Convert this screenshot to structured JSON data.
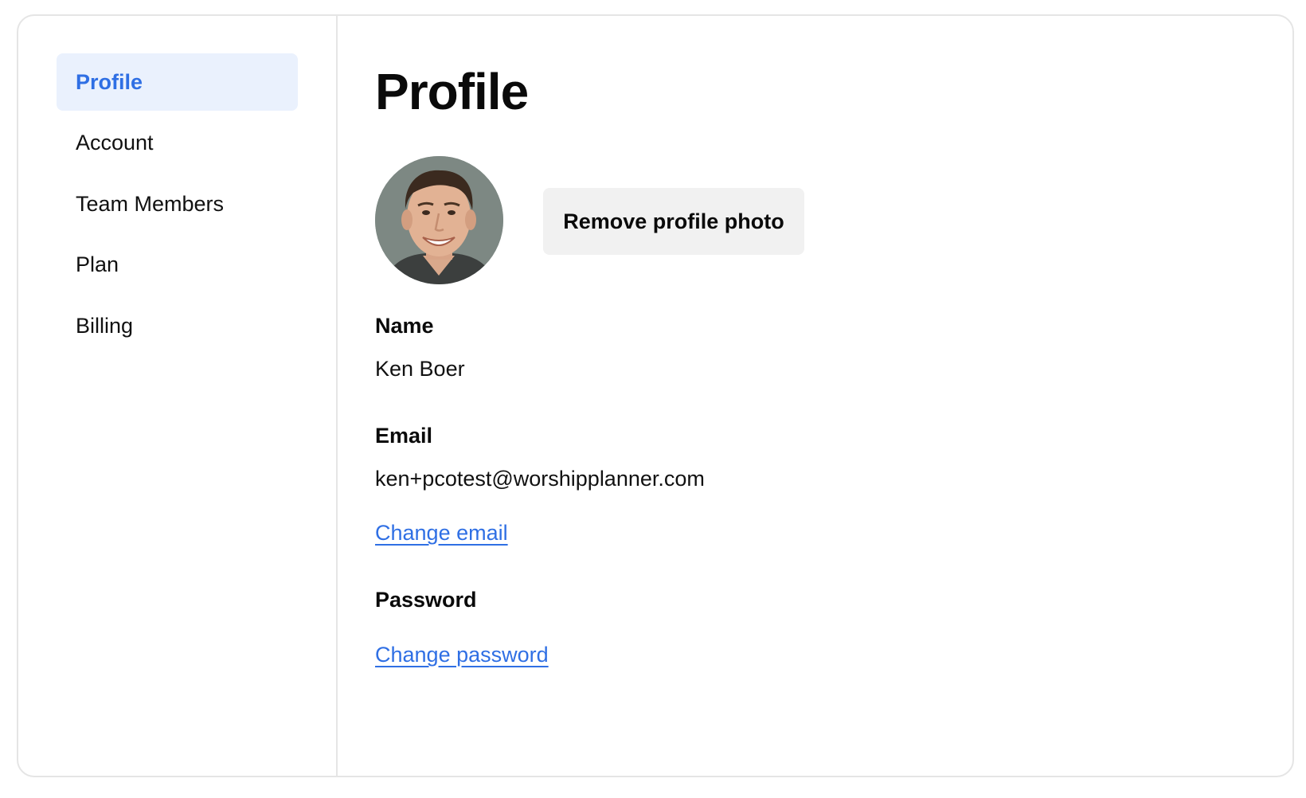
{
  "sidebar": {
    "items": [
      {
        "label": "Profile",
        "active": true
      },
      {
        "label": "Account",
        "active": false
      },
      {
        "label": "Team Members",
        "active": false
      },
      {
        "label": "Plan",
        "active": false
      },
      {
        "label": "Billing",
        "active": false
      }
    ]
  },
  "main": {
    "title": "Profile",
    "remove_photo_label": "Remove profile photo",
    "name": {
      "label": "Name",
      "value": "Ken Boer"
    },
    "email": {
      "label": "Email",
      "value": "ken+pcotest@worshipplanner.com",
      "change_link": "Change email"
    },
    "password": {
      "label": "Password",
      "change_link": "Change password"
    }
  },
  "colors": {
    "accent": "#2f6fe4",
    "active_nav_bg": "#eaf1fd",
    "button_bg": "#f1f1f1",
    "border": "#e5e5e5"
  }
}
